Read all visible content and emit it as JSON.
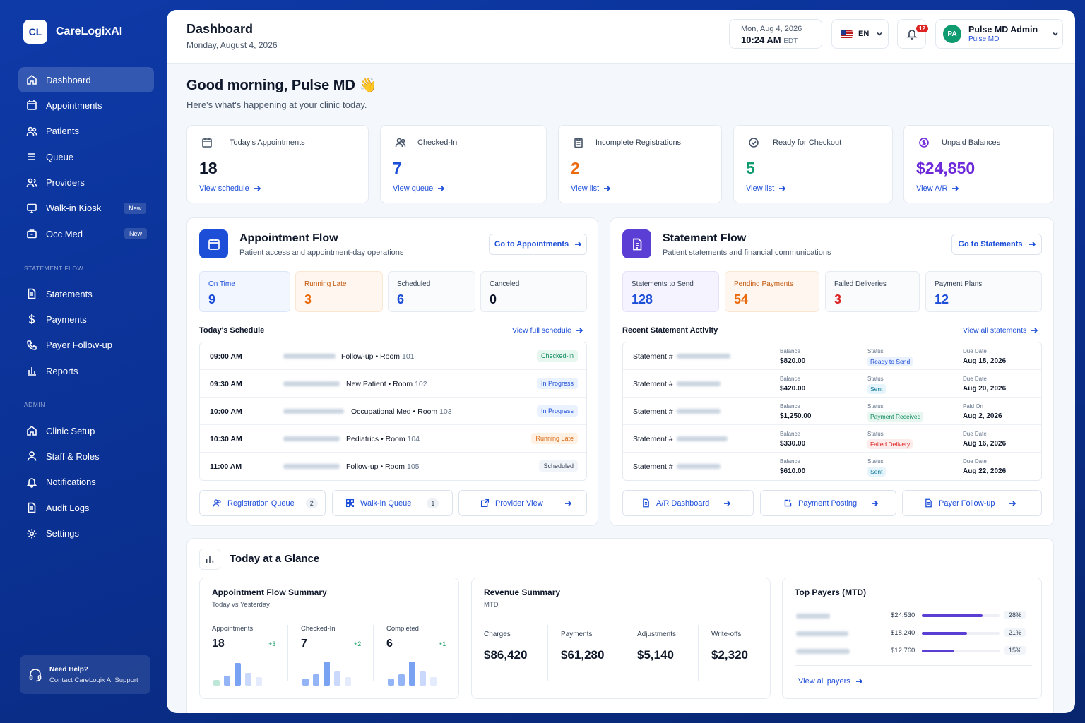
{
  "app": {
    "logo": "CL",
    "name": "CareLogixAI"
  },
  "sidebar": {
    "main": [
      {
        "label": "Dashboard",
        "icon": "home-icon",
        "active": true
      },
      {
        "label": "Appointments",
        "icon": "calendar-icon"
      },
      {
        "label": "Patients",
        "icon": "users-icon"
      },
      {
        "label": "Queue",
        "icon": "list-icon"
      },
      {
        "label": "Providers",
        "icon": "user-group-icon"
      },
      {
        "label": "Walk-in Kiosk",
        "icon": "monitor-icon",
        "badge": "New"
      },
      {
        "label": "Occ Med",
        "icon": "briefcase-icon",
        "badge": "New"
      }
    ],
    "statement_section": "STATEMENT FLOW",
    "statement": [
      {
        "label": "Statements",
        "icon": "document-icon"
      },
      {
        "label": "Payments",
        "icon": "dollar-icon"
      },
      {
        "label": "Payer Follow-up",
        "icon": "phone-icon"
      },
      {
        "label": "Reports",
        "icon": "bar-chart-icon"
      }
    ],
    "admin_section": "ADMIN",
    "admin": [
      {
        "label": "Clinic Setup",
        "icon": "home-icon"
      },
      {
        "label": "Staff & Roles",
        "icon": "user-icon"
      },
      {
        "label": "Notifications",
        "icon": "bell-icon"
      },
      {
        "label": "Audit Logs",
        "icon": "document-icon"
      },
      {
        "label": "Settings",
        "icon": "gear-icon"
      }
    ],
    "help": {
      "title": "Need Help?",
      "subtitle": "Contact CareLogix AI Support"
    }
  },
  "header": {
    "title": "Dashboard",
    "date": "Monday, August 4, 2026",
    "dt_date": "Mon, Aug 4, 2026",
    "dt_time": "10:24 AM",
    "dt_tz": "EDT",
    "lang": "EN",
    "notif_count": "12",
    "user_initials": "PA",
    "user_name": "Pulse MD Admin",
    "user_org": "Pulse MD"
  },
  "greeting": {
    "title": "Good morning, Pulse MD 👋",
    "subtitle": "Here's what's happening at your clinic today."
  },
  "stats": [
    {
      "label": "Today's Appointments",
      "value": "18",
      "link": "View schedule",
      "color": "#0f172a",
      "icon": "calendar-icon"
    },
    {
      "label": "Checked-In",
      "value": "7",
      "link": "View queue",
      "color": "#1d4ed8",
      "icon": "users-icon"
    },
    {
      "label": "Incomplete Registrations",
      "value": "2",
      "link": "View list",
      "color": "#ea6a0c",
      "icon": "clipboard-icon"
    },
    {
      "label": "Ready for Checkout",
      "value": "5",
      "link": "View list",
      "color": "#0d9b6f",
      "icon": "check-circle-icon"
    },
    {
      "label": "Unpaid Balances",
      "value": "$24,850",
      "link": "View A/R",
      "color": "#6d28d9",
      "icon": "dollar-circle-icon"
    }
  ],
  "appt_flow": {
    "title": "Appointment Flow",
    "subtitle": "Patient access and appointment-day operations",
    "button": "Go to Appointments",
    "kpis": [
      {
        "label": "On Time",
        "value": "9"
      },
      {
        "label": "Running Late",
        "value": "3"
      },
      {
        "label": "Scheduled",
        "value": "6"
      },
      {
        "label": "Canceled",
        "value": "0"
      }
    ],
    "schedule_title": "Today's Schedule",
    "schedule_link": "View full schedule",
    "schedule": [
      {
        "time": "09:00 AM",
        "type": "Follow-up",
        "room": "Room",
        "room_no": "101",
        "status": "Checked-In"
      },
      {
        "time": "09:30 AM",
        "type": "New Patient",
        "room": "Room",
        "room_no": "102",
        "status": "In Progress"
      },
      {
        "time": "10:00 AM",
        "type": "Occupational Med",
        "room": "Room",
        "room_no": "103",
        "status": "In Progress"
      },
      {
        "time": "10:30 AM",
        "type": "Pediatrics",
        "room": "Room",
        "room_no": "104",
        "status": "Running Late"
      },
      {
        "time": "11:00 AM",
        "type": "Follow-up",
        "room": "Room",
        "room_no": "105",
        "status": "Scheduled"
      }
    ],
    "buttons": [
      {
        "label": "Registration Queue",
        "count": "2"
      },
      {
        "label": "Walk-in Queue",
        "count": "1"
      },
      {
        "label": "Provider View"
      }
    ]
  },
  "stmt_flow": {
    "title": "Statement Flow",
    "subtitle": "Patient statements and financial communications",
    "button": "Go to Statements",
    "kpis": [
      {
        "label": "Statements to Send",
        "value": "128"
      },
      {
        "label": "Pending Payments",
        "value": "54"
      },
      {
        "label": "Failed Deliveries",
        "value": "3"
      },
      {
        "label": "Payment Plans",
        "value": "12"
      }
    ],
    "activity_title": "Recent Statement Activity",
    "activity_link": "View all statements",
    "activity": [
      {
        "name": "Statement #",
        "bal_label": "Balance",
        "balance": "$820.00",
        "st_label": "Status",
        "status": "Ready to Send",
        "d_label": "Due Date",
        "date": "Aug 18, 2026"
      },
      {
        "name": "Statement #",
        "bal_label": "Balance",
        "balance": "$420.00",
        "st_label": "Status",
        "status": "Sent",
        "d_label": "Due Date",
        "date": "Aug 20, 2026"
      },
      {
        "name": "Statement #",
        "bal_label": "Balance",
        "balance": "$1,250.00",
        "st_label": "Status",
        "status": "Payment Received",
        "d_label": "Paid On",
        "date": "Aug 2, 2026"
      },
      {
        "name": "Statement #",
        "bal_label": "Balance",
        "balance": "$330.00",
        "st_label": "Status",
        "status": "Failed Delivery",
        "d_label": "Due Date",
        "date": "Aug 16, 2026"
      },
      {
        "name": "Statement #",
        "bal_label": "Balance",
        "balance": "$610.00",
        "st_label": "Status",
        "status": "Sent",
        "d_label": "Due Date",
        "date": "Aug 22, 2026"
      }
    ],
    "buttons": [
      {
        "label": "A/R Dashboard"
      },
      {
        "label": "Payment Posting"
      },
      {
        "label": "Payer Follow-up"
      }
    ]
  },
  "glance": {
    "title": "Today at a Glance",
    "flow": {
      "title": "Appointment Flow Summary",
      "subtitle": "Today vs Yesterday",
      "metrics": [
        {
          "label": "Appointments",
          "value": "18",
          "delta": "+3"
        },
        {
          "label": "Checked-In",
          "value": "7",
          "delta": "+2"
        },
        {
          "label": "Completed",
          "value": "6",
          "delta": "+1"
        }
      ]
    },
    "revenue": {
      "title": "Revenue Summary",
      "subtitle": "MTD",
      "items": [
        {
          "label": "Charges",
          "value": "$86,420"
        },
        {
          "label": "Payments",
          "value": "$61,280"
        },
        {
          "label": "Adjustments",
          "value": "$5,140"
        },
        {
          "label": "Write-offs",
          "value": "$2,320"
        }
      ]
    },
    "payers": {
      "title": "Top Payers (MTD)",
      "items": [
        {
          "amount": "$24,530",
          "pct": "28%",
          "share": 0.28
        },
        {
          "amount": "$18,240",
          "pct": "21%",
          "share": 0.21
        },
        {
          "amount": "$12,760",
          "pct": "15%",
          "share": 0.15
        }
      ],
      "link": "View all payers"
    }
  }
}
